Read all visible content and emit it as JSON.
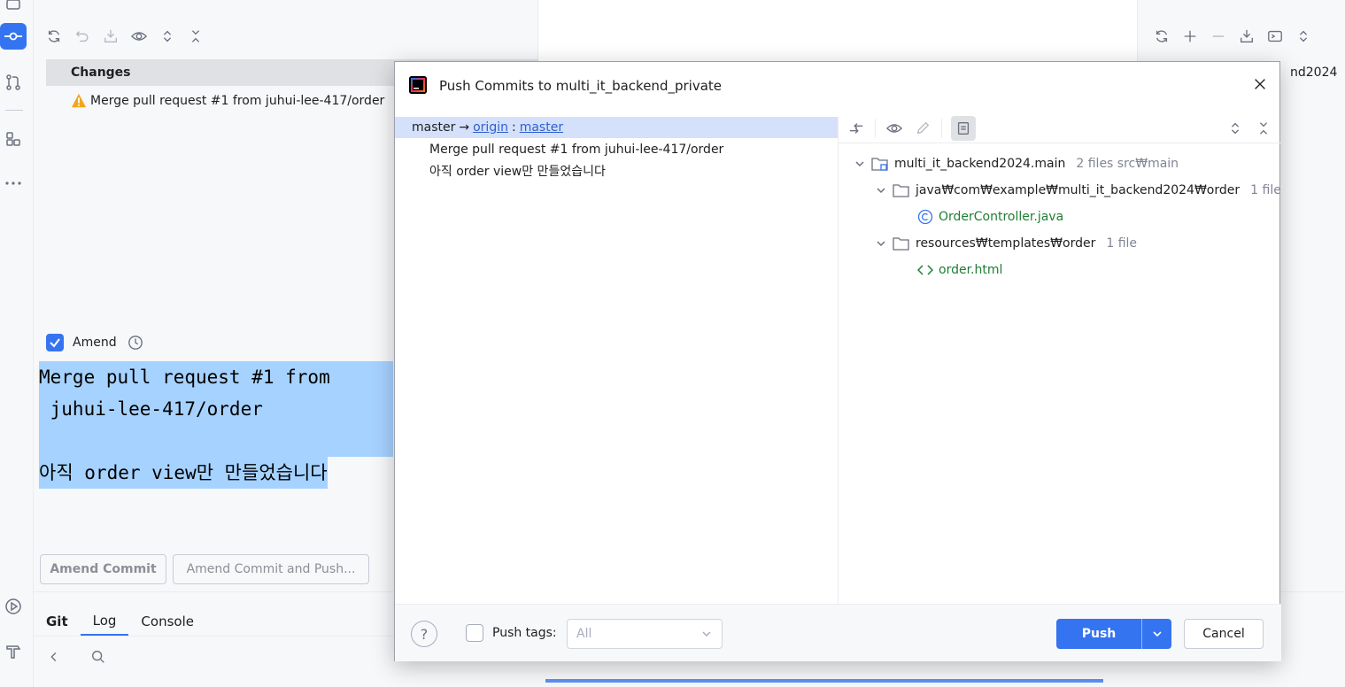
{
  "commit_panel": {
    "changes_header": "Changes",
    "change_item": "Merge pull request #1 from juhui-lee-417/order",
    "amend_label": "Amend",
    "amend_checked": true,
    "message_lines": [
      "Merge pull request #1 from",
      " juhui-lee-417/order",
      "",
      "아직 order view만 만들었습니다"
    ],
    "amend_commit_button": "Amend Commit",
    "amend_commit_push_button": "Amend Commit and Push..."
  },
  "right_panel": {
    "partial_label": "nd2024"
  },
  "bottom": {
    "tabs": [
      "Git",
      "Log",
      "Console"
    ],
    "active_tab": "Log"
  },
  "dialog": {
    "title": "Push Commits to multi_it_backend_private",
    "branch": {
      "local": "master",
      "arrow": "→",
      "remote": "origin",
      "separator": ":",
      "remote_branch": "master"
    },
    "commits": [
      "Merge pull request #1 from juhui-lee-417/order",
      "아직 order view만 만들었습니다"
    ],
    "tree": {
      "root": {
        "name": "multi_it_backend2024.main",
        "info": "2 files  src₩main"
      },
      "dir1": {
        "name": "java₩com₩example₩multi_it_backend2024₩order",
        "info": "1 file"
      },
      "file1": "OrderController.java",
      "dir2": {
        "name": "resources₩templates₩order",
        "info": "1 file"
      },
      "file2": "order.html"
    },
    "footer": {
      "help": "?",
      "push_tags_label": "Push tags:",
      "tags_value": "All",
      "push_button": "Push",
      "cancel_button": "Cancel"
    }
  },
  "colors": {
    "accent": "#3574f0",
    "selection": "#a6d2ff",
    "branch_row": "#d5e1fb",
    "file_green": "#1e7e34",
    "link": "#2e5fd1"
  }
}
